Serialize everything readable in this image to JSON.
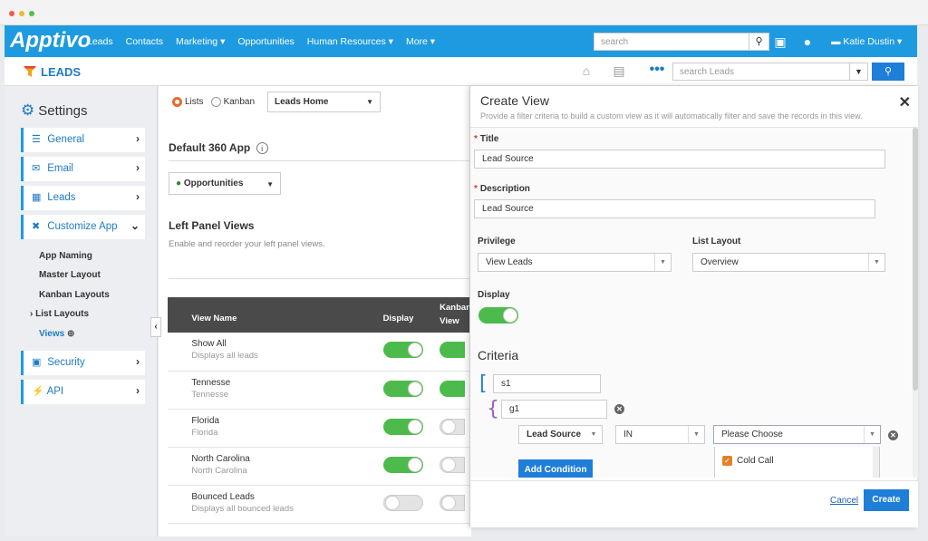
{
  "nav": {
    "logo": "Apptivo",
    "links": [
      "Leads",
      "Contacts",
      "Marketing ▾",
      "Opportunities",
      "Human Resources ▾",
      "More ▾"
    ],
    "search_placeholder": "search",
    "user": "Katie Dustin ▾"
  },
  "leads_bar": {
    "title": "LEADS",
    "search_placeholder": "search Leads"
  },
  "sidebar": {
    "title": "Settings",
    "items": [
      {
        "label": "General",
        "icon": "list-icon"
      },
      {
        "label": "Email",
        "icon": "envelope-icon"
      },
      {
        "label": "Leads",
        "icon": "card-icon"
      },
      {
        "label": "Customize App",
        "icon": "tools-icon"
      },
      {
        "label": "Security",
        "icon": "lock-icon"
      },
      {
        "label": "API",
        "icon": "plug-icon"
      }
    ],
    "subitems": [
      "App Naming",
      "Master Layout",
      "Kanban Layouts",
      "List Layouts",
      "Views"
    ]
  },
  "main": {
    "view_mode": {
      "lists": "Lists",
      "kanban": "Kanban"
    },
    "home_dropdown": "Leads Home",
    "default_app_title": "Default 360 App",
    "app_dropdown": "Opportunities",
    "left_panel_title": "Left Panel Views",
    "left_panel_desc": "Enable and reorder your left panel views.",
    "table": {
      "headers": {
        "view_name": "View Name",
        "display": "Display",
        "kanban_view": "Kanban View"
      },
      "rows": [
        {
          "name": "Show All",
          "desc": "Displays all leads",
          "display": true,
          "kanban": true
        },
        {
          "name": "Tennesse",
          "desc": "Tennesse",
          "display": true,
          "kanban": true
        },
        {
          "name": "Florida",
          "desc": "Florida",
          "display": true,
          "kanban": false
        },
        {
          "name": "North Carolina",
          "desc": "North Carolina",
          "display": true,
          "kanban": false
        },
        {
          "name": "Bounced Leads",
          "desc": "Displays all bounced leads",
          "display": false,
          "kanban": false
        }
      ]
    }
  },
  "modal": {
    "title": "Create View",
    "subtitle": "Provide a filter criteria to build a custom view as it will automatically filter and save the records in this view.",
    "title_label": "Title",
    "title_value": "Lead Source",
    "description_label": "Description",
    "description_value": "Lead Source",
    "privilege_label": "Privilege",
    "privilege_value": "View Leads",
    "list_layout_label": "List Layout",
    "list_layout_value": "Overview",
    "display_label": "Display",
    "display_on": true,
    "criteria_title": "Criteria",
    "group_s": "s1",
    "group_g": "g1",
    "condition_field": "Lead Source",
    "condition_operator": "IN",
    "condition_value_placeholder": "Please Choose",
    "choose_option": "Cold Call",
    "add_condition": "Add Condition",
    "cancel": "Cancel",
    "create": "Create"
  },
  "colors": {
    "nav": "#1e9be0",
    "accent": "#1e7ed8",
    "toggle_on": "#4cbb4c",
    "radio": "#e86a2a"
  }
}
